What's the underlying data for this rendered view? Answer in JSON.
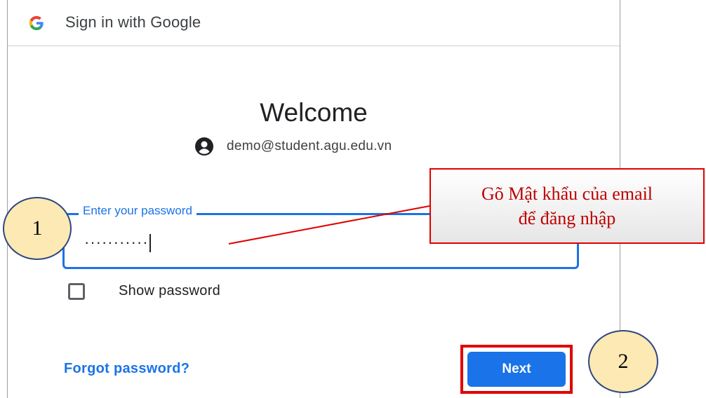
{
  "window": {
    "title": "Sign in with Google"
  },
  "main": {
    "heading": "Welcome",
    "account_email": "demo@student.agu.edu.vn",
    "password_field": {
      "label": "Enter your password",
      "value": "···········"
    },
    "show_password_label": "Show password",
    "forgot_link": "Forgot password?",
    "next_button": "Next"
  },
  "annotations": {
    "badge_1": "1",
    "badge_2": "2",
    "callout_line1": "Gõ Mật khẩu của email",
    "callout_line2": "để đăng nhập"
  },
  "colors": {
    "accent": "#1a73e8",
    "annotation_red": "#e00000",
    "badge_fill": "#fde9b3"
  },
  "icons": [
    "google-logo-icon",
    "account-circle-icon",
    "checkbox-icon"
  ]
}
